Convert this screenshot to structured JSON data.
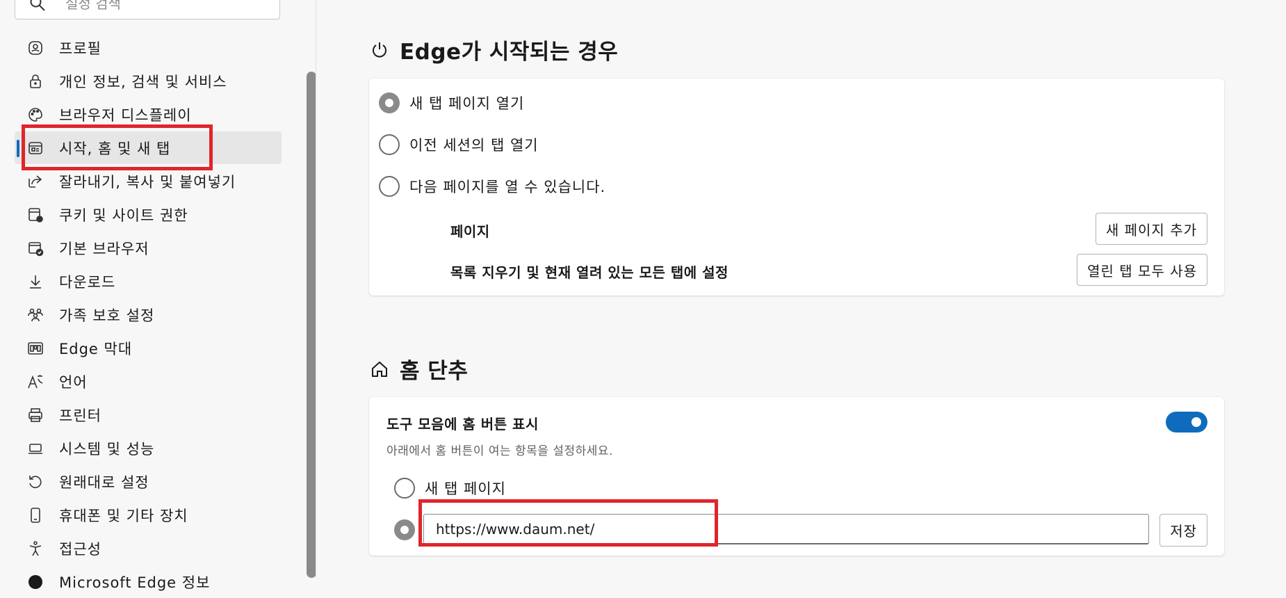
{
  "sidebar": {
    "search_placeholder": "설정 검색",
    "items": [
      {
        "label": "프로필",
        "icon": "profile-icon"
      },
      {
        "label": "개인 정보, 검색 및 서비스",
        "icon": "lock-icon"
      },
      {
        "label": "브라우저 디스플레이",
        "icon": "palette-icon"
      },
      {
        "label": "시작, 홈 및 새 탭",
        "icon": "start-home-icon",
        "active": true
      },
      {
        "label": "잘라내기, 복사 및 붙여넣기",
        "icon": "share-icon"
      },
      {
        "label": "쿠키 및 사이트 권한",
        "icon": "cookie-settings-icon"
      },
      {
        "label": "기본 브라우저",
        "icon": "default-browser-icon"
      },
      {
        "label": "다운로드",
        "icon": "download-icon"
      },
      {
        "label": "가족 보호 설정",
        "icon": "family-icon"
      },
      {
        "label": "Edge 막대",
        "icon": "edge-bar-icon"
      },
      {
        "label": "언어",
        "icon": "language-icon"
      },
      {
        "label": "프린터",
        "icon": "printer-icon"
      },
      {
        "label": "시스템 및 성능",
        "icon": "laptop-icon"
      },
      {
        "label": "원래대로 설정",
        "icon": "reset-icon"
      },
      {
        "label": "휴대폰 및 기타 장치",
        "icon": "phone-icon"
      },
      {
        "label": "접근성",
        "icon": "accessibility-icon"
      },
      {
        "label": "Microsoft Edge 정보",
        "icon": "edge-logo-icon"
      }
    ]
  },
  "startup": {
    "title": "Edge가 시작되는 경우",
    "icon": "power-icon",
    "options": [
      {
        "label": "새 탭 페이지 열기",
        "checked": true
      },
      {
        "label": "이전 세션의 탭 열기",
        "checked": false
      },
      {
        "label": "다음 페이지를 열 수 있습니다.",
        "checked": false
      }
    ],
    "pages_label": "페이지",
    "add_page_button": "새 페이지 추가",
    "clear_label": "목록 지우기 및 현재 열려 있는 모든 탭에 설정",
    "use_all_tabs_button": "열린 탭 모두 사용"
  },
  "home": {
    "title": "홈 단추",
    "icon": "home-icon",
    "show_button_label": "도구 모음에 홈 버튼 표시",
    "show_button_description": "아래에서 홈 버튼이 여는 항목을 설정하세요.",
    "toggle_on": true,
    "option_new_tab": "새 탭 페이지",
    "url_value": "https://www.daum.net/",
    "save_button": "저장"
  },
  "colors": {
    "accent": "#0f6cbd",
    "highlight": "#e0252b",
    "background": "#f7f7f7"
  }
}
